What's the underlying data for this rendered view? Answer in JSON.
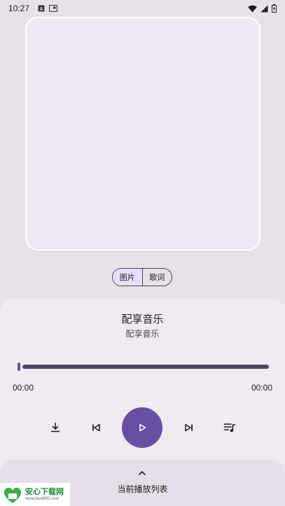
{
  "status_bar": {
    "time": "10:27",
    "left_icons": [
      "a-notification-icon",
      "media-notification-icon"
    ],
    "right_icons": [
      "wifi-icon",
      "signal-icon",
      "battery-icon"
    ]
  },
  "album_art": {
    "icon": "album-art-placeholder"
  },
  "view_toggle": {
    "options": [
      "图片",
      "歌词"
    ],
    "selected": "图片"
  },
  "track": {
    "title": "配享音乐",
    "artist": "配享音乐"
  },
  "progress": {
    "current_time": "00:00",
    "total_time": "00:00",
    "fraction": 0
  },
  "controls": {
    "icons": [
      "download-icon",
      "previous-icon",
      "play-icon",
      "next-icon",
      "playlist-icon"
    ]
  },
  "queue": {
    "label": "当前播放列表",
    "icon": "chevron-up-icon"
  },
  "watermark": {
    "brand": "安心下载网",
    "url": "www.java800.com"
  },
  "colors": {
    "background": "#e8e1ea",
    "panel": "#f1eaf3",
    "accent": "#6750a4",
    "track": "#4f4a5a"
  }
}
